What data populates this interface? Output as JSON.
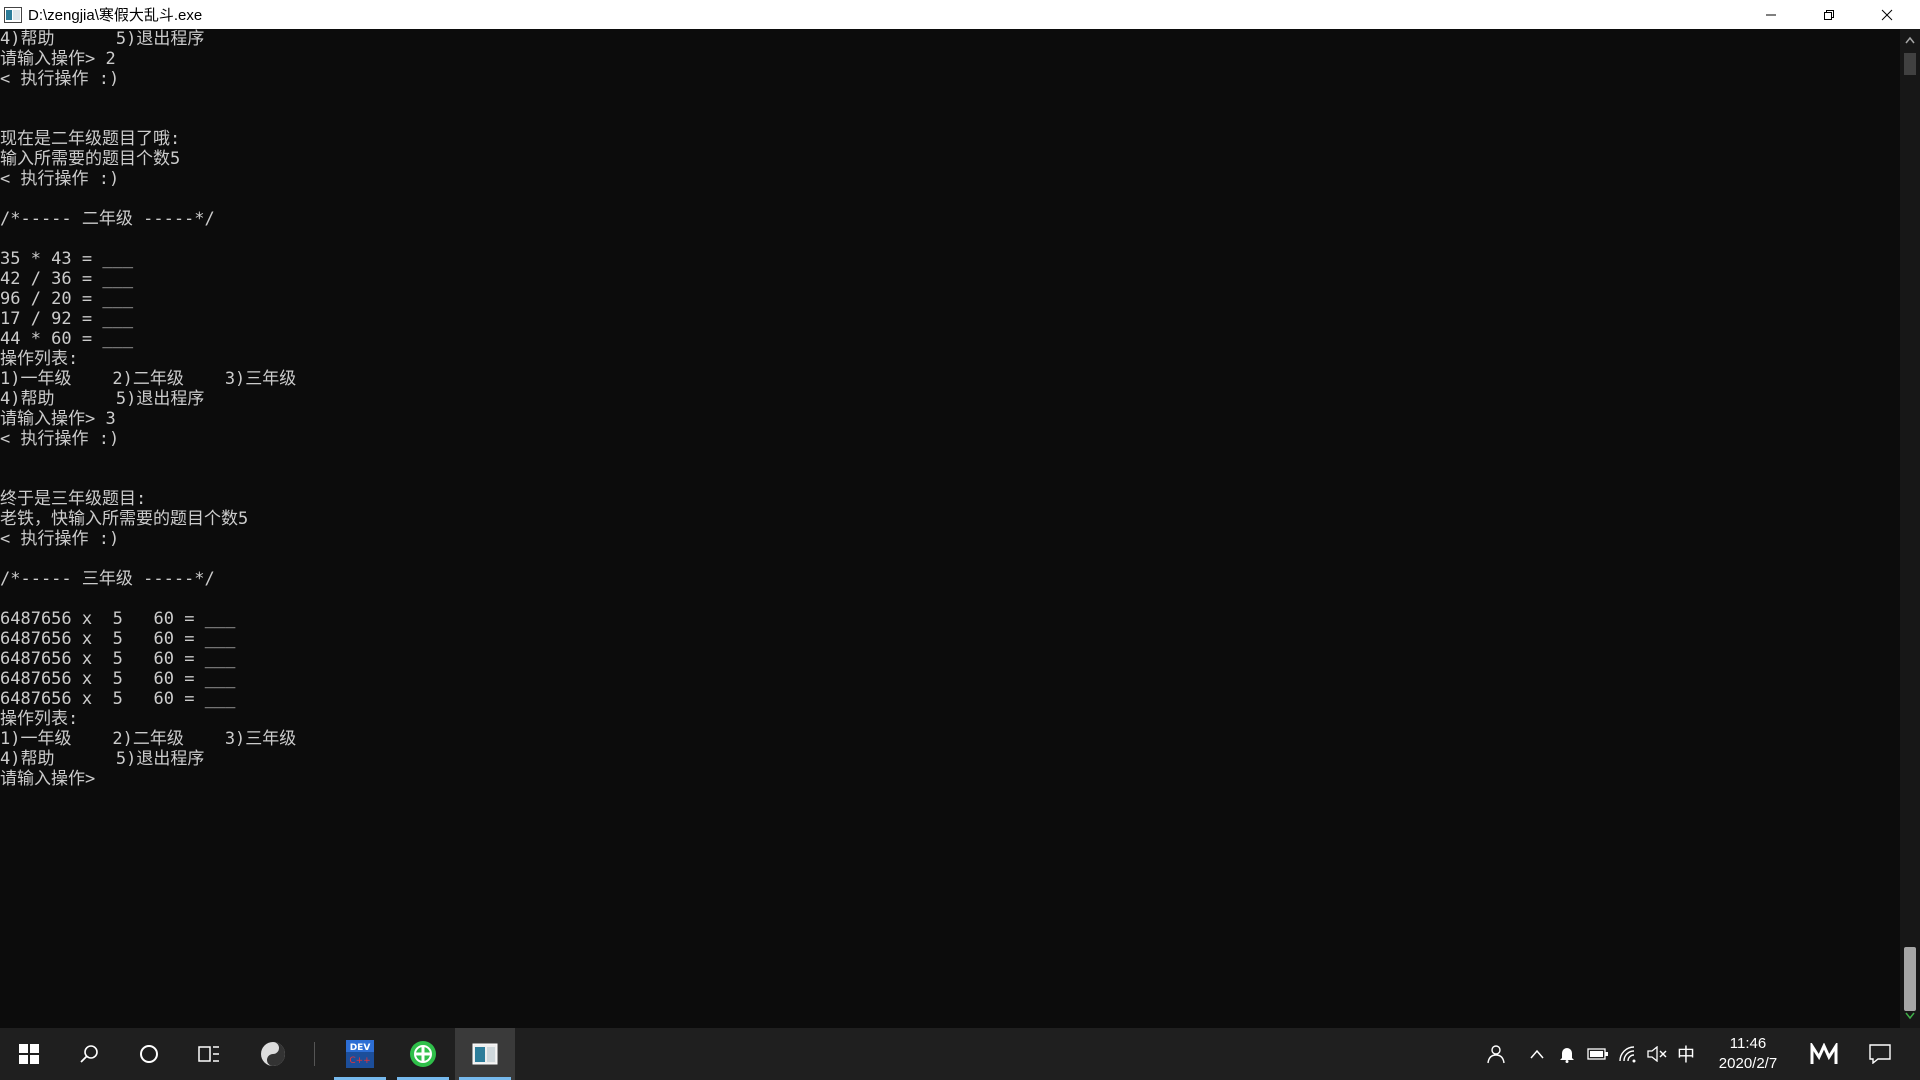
{
  "window": {
    "title": "D:\\zengjia\\寒假大乱斗.exe"
  },
  "console": {
    "lines": [
      "4)帮助      5)退出程序",
      "请输入操作> 2",
      "< 执行操作 :)",
      "",
      "",
      "现在是二年级题目了哦:",
      "输入所需要的题目个数5",
      "< 执行操作 :)",
      "",
      "/*----- 二年级 -----*/",
      "",
      "35 * 43 = ___",
      "42 / 36 = ___",
      "96 / 20 = ___",
      "17 / 92 = ___",
      "44 * 60 = ___",
      "操作列表:",
      "1)一年级    2)二年级    3)三年级",
      "4)帮助      5)退出程序",
      "请输入操作> 3",
      "< 执行操作 :)",
      "",
      "",
      "终于是三年级题目:",
      "老铁，快输入所需要的题目个数5",
      "< 执行操作 :)",
      "",
      "/*----- 三年级 -----*/",
      "",
      "6487656 x  5   60 = ___",
      "6487656 x  5   60 = ___",
      "6487656 x  5   60 = ___",
      "6487656 x  5   60 = ___",
      "6487656 x  5   60 = ___",
      "操作列表:",
      "1)一年级    2)二年级    3)三年级",
      "4)帮助      5)退出程序",
      "请输入操作>"
    ]
  },
  "taskbar": {
    "apps": [
      {
        "name": "dev-cpp",
        "label": "DEV C++"
      },
      {
        "name": "browser",
        "label": ""
      },
      {
        "name": "console-app",
        "label": ""
      }
    ],
    "tray": {
      "ime": "中"
    },
    "clock": {
      "time": "11:46",
      "date": "2020/2/7"
    }
  },
  "colors": {
    "console_bg": "#0c0c0c",
    "console_text": "#cccccc",
    "taskbar_bg": "#1f1f1f",
    "accent": "#76b9ed"
  }
}
